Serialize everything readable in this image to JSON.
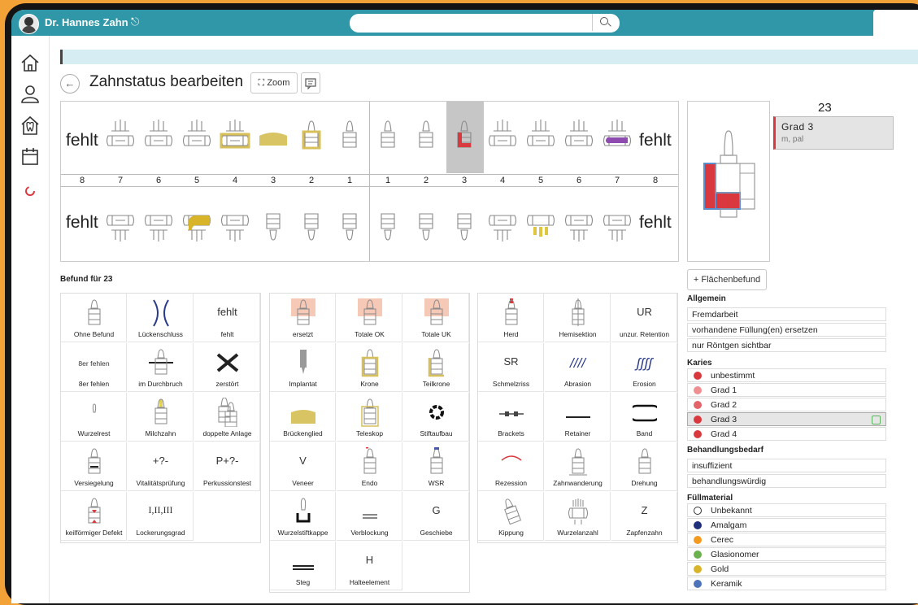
{
  "header": {
    "user_name": "Dr. Hannes Zahn",
    "logout_glyph": "⎋",
    "search_placeholder": ""
  },
  "page": {
    "back_glyph": "←",
    "title": "Zahnstatus bearbeiten",
    "zoom_label": "Zoom",
    "zoom_glyph": "⛶"
  },
  "chart": {
    "upper_left_missing": "fehlt",
    "upper_right_missing": "fehlt",
    "lower_left_missing": "fehlt",
    "lower_right_missing": "fehlt",
    "numbers": [
      "8",
      "7",
      "6",
      "5",
      "4",
      "3",
      "2",
      "1",
      "1",
      "2",
      "3",
      "4",
      "5",
      "6",
      "7",
      "8"
    ]
  },
  "detail": {
    "tooth_number": "23",
    "grad_title": "Grad 3",
    "grad_sub": "m, pal",
    "flaeche_label": "Flächenbefund",
    "flaeche_glyph": "+"
  },
  "befund": {
    "title": "Befund für 23",
    "col1": [
      "Ohne Befund",
      "Lückenschluss",
      "fehlt",
      "8er fehlen",
      "im Durchbruch",
      "zerstört",
      "Wurzelrest",
      "Milchzahn",
      "doppelte Anlage",
      "Versiegelung",
      "Vitalitätsprüfung",
      "Perkussionstest",
      "keilförmiger Defekt",
      "Lockerungsgrad"
    ],
    "col1_text": {
      "fehlt": "fehlt",
      "8er": "8er fehlen",
      "vital": "+?-",
      "perk": "P+?-",
      "locker": "I,II,III"
    },
    "col2": [
      "ersetzt",
      "Totale OK",
      "Totale UK",
      "Implantat",
      "Krone",
      "Teilkrone",
      "Brückenglied",
      "Teleskop",
      "Stiftaufbau",
      "Veneer",
      "Endo",
      "WSR",
      "Wurzelstiftkappe",
      "Verblockung",
      "Geschiebe",
      "Steg",
      "Halteelement"
    ],
    "col2_text": {
      "veneer": "V",
      "geschiebe": "G",
      "halte": "H"
    },
    "col3": [
      "Herd",
      "Hemisektion",
      "unzur. Retention",
      "Schmelzriss",
      "Abrasion",
      "Erosion",
      "Brackets",
      "Retainer",
      "Band",
      "Rezession",
      "Zahnwanderung",
      "Drehung",
      "Kippung",
      "Wurzelanzahl",
      "Zapfenzahn"
    ],
    "col3_text": {
      "ur": "UR",
      "sr": "SR",
      "z": "Z",
      "abrasion": "////",
      "erosion": "ʃʃʃʃ"
    }
  },
  "panel": {
    "allgemein": {
      "title": "Allgemein",
      "items": [
        "Fremdarbeit",
        "vorhandene Füllung(en) ersetzen",
        "nur Röntgen sichtbar"
      ]
    },
    "karies": {
      "title": "Karies",
      "items": [
        {
          "label": "unbestimmt",
          "color": "#d9393e"
        },
        {
          "label": "Grad 1",
          "color": "#ef8f92"
        },
        {
          "label": "Grad 2",
          "color": "#e26368"
        },
        {
          "label": "Grad 3",
          "color": "#d9393e"
        },
        {
          "label": "Grad 4",
          "color": "#d9393e"
        }
      ]
    },
    "bedarf": {
      "title": "Behandlungsbedarf",
      "items": [
        "insuffizient",
        "behandlungswürdig"
      ]
    },
    "fuell": {
      "title": "Füllmaterial",
      "items": [
        {
          "label": "Unbekannt",
          "color": "#ffffff"
        },
        {
          "label": "Amalgam",
          "color": "#1f2f7a"
        },
        {
          "label": "Cerec",
          "color": "#f39a1f"
        },
        {
          "label": "Glasionomer",
          "color": "#6ab04c"
        },
        {
          "label": "Gold",
          "color": "#d8b42a"
        },
        {
          "label": "Keramik",
          "color": "#4d73b8"
        }
      ]
    }
  }
}
